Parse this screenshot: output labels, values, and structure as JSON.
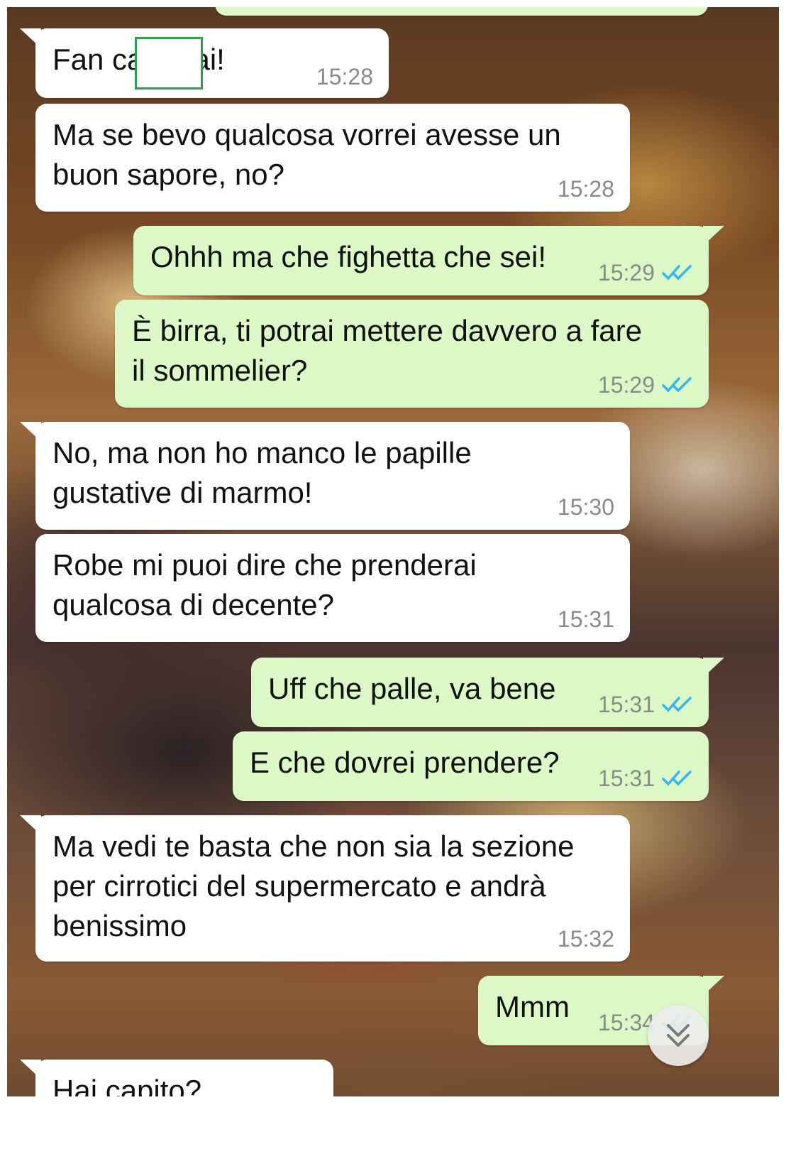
{
  "conversation": {
    "messages": [
      {
        "id": 1,
        "direction": "incoming",
        "text": "Fan ca      e dai!",
        "time": "15:28",
        "censored": true
      },
      {
        "id": 2,
        "direction": "incoming",
        "text": "Ma se bevo qualcosa vorrei avesse un\nbuon sapore, no?",
        "time": "15:28"
      },
      {
        "id": 3,
        "direction": "outgoing",
        "text": "Ohhh ma che fighetta che sei!",
        "time": "15:29",
        "status": "read"
      },
      {
        "id": 4,
        "direction": "outgoing",
        "text": "È birra, ti potrai mettere davvero a fare\nil sommelier?",
        "time": "15:29",
        "status": "read"
      },
      {
        "id": 5,
        "direction": "incoming",
        "text": "No, ma non ho manco le papille\ngustative di marmo!",
        "time": "15:30"
      },
      {
        "id": 6,
        "direction": "incoming",
        "text": "Robe mi puoi dire che prenderai\nqualcosa di decente?",
        "time": "15:31"
      },
      {
        "id": 7,
        "direction": "outgoing",
        "text": "Uff che palle, va bene",
        "time": "15:31",
        "status": "read"
      },
      {
        "id": 8,
        "direction": "outgoing",
        "text": "E che dovrei prendere?",
        "time": "15:31",
        "status": "read"
      },
      {
        "id": 9,
        "direction": "incoming",
        "text": "Ma vedi te basta che non sia la sezione\nper cirrotici del supermercato e andrà\nbenissimo",
        "time": "15:32"
      },
      {
        "id": 10,
        "direction": "outgoing",
        "text": "Mmm",
        "time": "15:34",
        "status": "read"
      },
      {
        "id": 11,
        "direction": "incoming",
        "text": "Hai capito?",
        "time": ""
      }
    ]
  },
  "icons": {
    "read_receipt": "double-check-icon",
    "read_color": "#34b7f1",
    "scroll_down": "double-chevron-down-icon"
  },
  "colors": {
    "incoming_bubble": "#ffffff",
    "outgoing_bubble": "#dcf8c6",
    "timestamp": "#8a8a8a",
    "censor_border": "#2e9e4f"
  }
}
